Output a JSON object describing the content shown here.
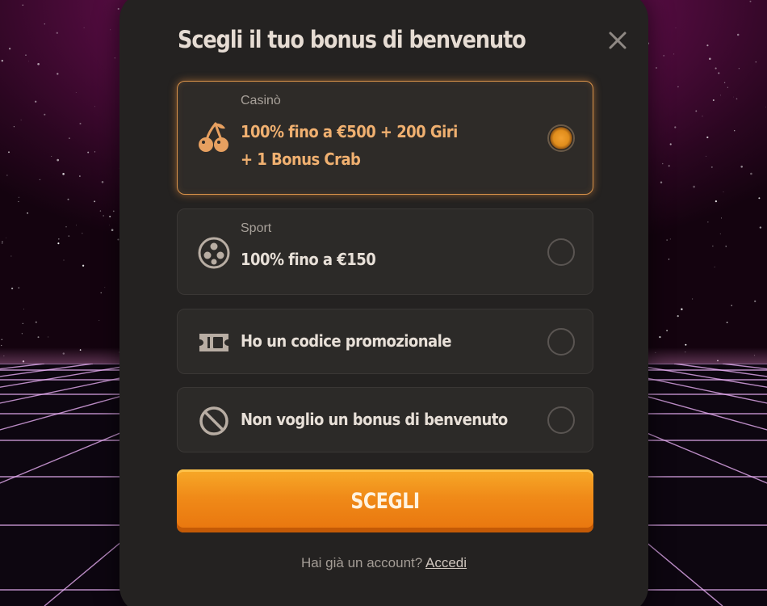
{
  "modal": {
    "title": "Scegli il tuo bonus di benvenuto",
    "close_icon": "close-icon"
  },
  "options": [
    {
      "category": "Casinò",
      "line1": "100% fino a €500 + 200 Giri",
      "line2": "+ 1 Bonus Crab",
      "icon": "cherries-icon",
      "selected": true
    },
    {
      "category": "Sport",
      "line1": "100% fino a €150",
      "icon": "soccer-ball-icon",
      "selected": false
    },
    {
      "line1": "Ho un codice promozionale",
      "icon": "ticket-icon",
      "selected": false
    },
    {
      "line1": "Non voglio un bonus di benvenuto",
      "icon": "prohibited-icon",
      "selected": false
    }
  ],
  "button": {
    "label": "SCEGLI"
  },
  "footer": {
    "text": "Hai già un account?",
    "link": "Accedi"
  },
  "colors": {
    "accent": "#f08a18",
    "selected_text": "#f0b070",
    "modal_bg": "#242221",
    "background_magenta": "#8a1660"
  }
}
